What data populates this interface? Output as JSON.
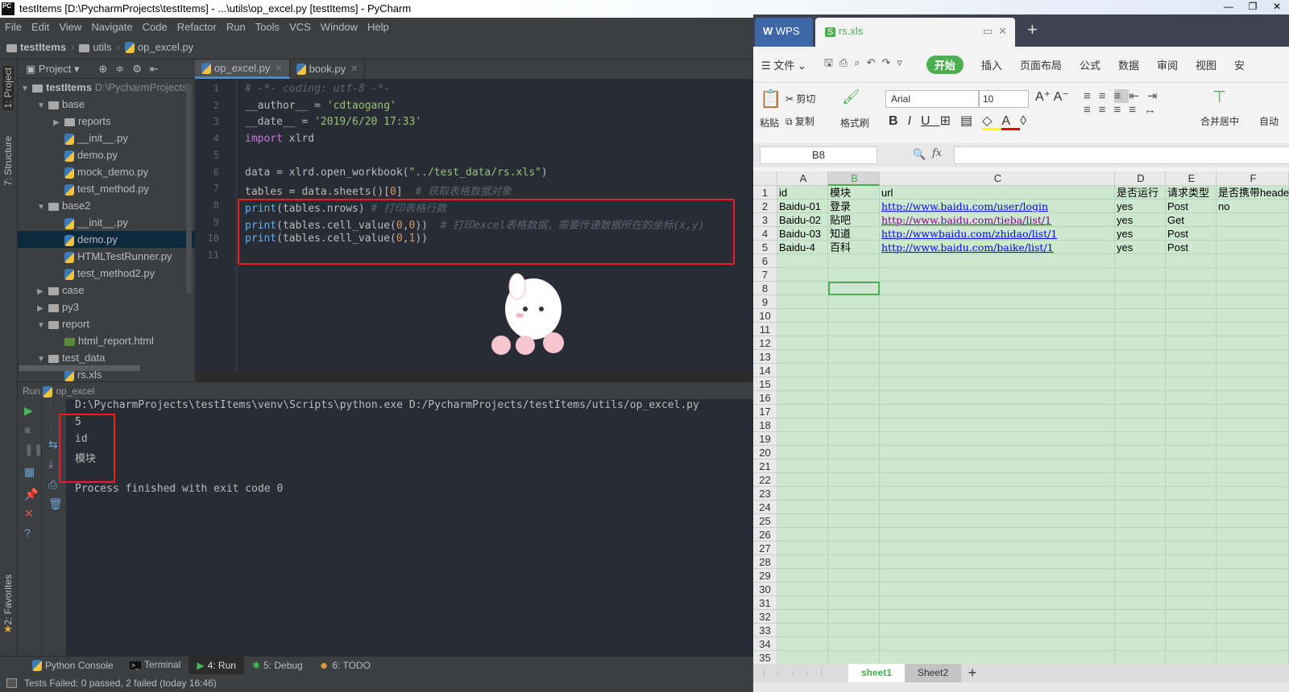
{
  "window": {
    "title": "testItems [D:\\PycharmProjects\\testItems] - ...\\utils\\op_excel.py [testItems] - PyCharm",
    "app_icon": "PC",
    "controls": [
      "—",
      "❐",
      "✕"
    ]
  },
  "menu": [
    "File",
    "Edit",
    "View",
    "Navigate",
    "Code",
    "Refactor",
    "Run",
    "Tools",
    "VCS",
    "Window",
    "Help"
  ],
  "breadcrumb": [
    "testItems",
    "utils",
    "op_excel.py"
  ],
  "side_stripe": {
    "project": "1: Project",
    "structure": "7: Structure",
    "favorites": "2: Favorites"
  },
  "project": {
    "label": "Project",
    "root": "testItems",
    "root_path": "D:\\PycharmProjects\\",
    "tree": [
      {
        "label": "base",
        "type": "folder",
        "depth": 1,
        "open": true
      },
      {
        "label": "reports",
        "type": "folder",
        "depth": 2,
        "open": false
      },
      {
        "label": "__init__.py",
        "type": "py",
        "depth": 2
      },
      {
        "label": "demo.py",
        "type": "py",
        "depth": 2
      },
      {
        "label": "mock_demo.py",
        "type": "py",
        "depth": 2
      },
      {
        "label": "test_method.py",
        "type": "py",
        "depth": 2
      },
      {
        "label": "base2",
        "type": "folder",
        "depth": 1,
        "open": true
      },
      {
        "label": "__init__.py",
        "type": "py",
        "depth": 2
      },
      {
        "label": "demo.py",
        "type": "py",
        "depth": 2,
        "selected": true
      },
      {
        "label": "HTMLTestRunner.py",
        "type": "py",
        "depth": 2
      },
      {
        "label": "test_method2.py",
        "type": "py",
        "depth": 2
      },
      {
        "label": "case",
        "type": "folder",
        "depth": 1,
        "open": false
      },
      {
        "label": "py3",
        "type": "folder",
        "depth": 1,
        "open": false
      },
      {
        "label": "report",
        "type": "folder",
        "depth": 1,
        "open": true
      },
      {
        "label": "html_report.html",
        "type": "html",
        "depth": 2
      },
      {
        "label": "test_data",
        "type": "folder",
        "depth": 1,
        "open": true
      },
      {
        "label": "rs.xls",
        "type": "xls",
        "depth": 2
      }
    ]
  },
  "editor": {
    "tabs": [
      {
        "label": "op_excel.py",
        "active": true
      },
      {
        "label": "book.py",
        "active": false
      }
    ],
    "lines": [
      [
        {
          "t": "# -*- coding: utf-8 -*-",
          "c": "cm"
        }
      ],
      [
        {
          "t": "__author__ = ",
          "c": ""
        },
        {
          "t": "'cdtaogang'",
          "c": "str"
        }
      ],
      [
        {
          "t": "__date__ = ",
          "c": ""
        },
        {
          "t": "'2019/6/20 17:33'",
          "c": "str"
        }
      ],
      [
        {
          "t": "import",
          "c": "kw"
        },
        {
          "t": " xlrd",
          "c": ""
        }
      ],
      [],
      [
        {
          "t": "data = xlrd.open_workbook(",
          "c": ""
        },
        {
          "t": "\"../test_data/rs.xls\"",
          "c": "str"
        },
        {
          "t": ")",
          "c": ""
        }
      ],
      [
        {
          "t": "tables = data.sheets()[",
          "c": ""
        },
        {
          "t": "0",
          "c": "num"
        },
        {
          "t": "]  ",
          "c": ""
        },
        {
          "t": "# 获取表格数据对象",
          "c": "cm"
        }
      ],
      [
        {
          "t": "print",
          "c": "fn"
        },
        {
          "t": "(tables.nrows) ",
          "c": ""
        },
        {
          "t": "# 打印表格行数",
          "c": "cm"
        }
      ],
      [
        {
          "t": "print",
          "c": "fn"
        },
        {
          "t": "(tables.cell_value(",
          "c": ""
        },
        {
          "t": "0",
          "c": "num"
        },
        {
          "t": ",",
          "c": ""
        },
        {
          "t": "0",
          "c": "num"
        },
        {
          "t": "))  ",
          "c": ""
        },
        {
          "t": "# 打印excel表格数据，需要传递数据所在的坐标(x,y)",
          "c": "cm"
        }
      ],
      [
        {
          "t": "print",
          "c": "fn"
        },
        {
          "t": "(tables.cell_value(",
          "c": ""
        },
        {
          "t": "0",
          "c": "num"
        },
        {
          "t": ",",
          "c": ""
        },
        {
          "t": "1",
          "c": "num"
        },
        {
          "t": "))",
          "c": ""
        }
      ],
      []
    ]
  },
  "run": {
    "header": "Run",
    "config": "op_excel",
    "output": [
      "D:\\PycharmProjects\\testItems\\venv\\Scripts\\python.exe D:/PycharmProjects/testItems/utils/op_excel.py",
      "5",
      "id",
      "模块",
      "",
      "Process finished with exit code 0"
    ]
  },
  "tool_windows": [
    {
      "label": "Python Console",
      "icon": "python-icon"
    },
    {
      "label": "Terminal",
      "icon": "terminal-icon"
    },
    {
      "label": "4: Run",
      "icon": "run-icon",
      "active": true
    },
    {
      "label": "5: Debug",
      "icon": "bug-icon"
    },
    {
      "label": "6: TODO",
      "icon": "todo-icon"
    }
  ],
  "status": "Tests Failed: 0 passed, 2 failed (today 16:46)",
  "wps": {
    "brand": "WPS",
    "file_tab": "rs.xls",
    "menu": {
      "file": "文件",
      "tabs": [
        "开始",
        "插入",
        "页面布局",
        "公式",
        "数据",
        "审阅",
        "视图",
        "安"
      ]
    },
    "ribbon": {
      "paste": "粘贴",
      "cut": "剪切",
      "copy": "复制",
      "format_painter": "格式刷",
      "font": "Arial",
      "size": "10",
      "merge": "合并居中",
      "autowrap": "自动"
    },
    "name_box": "B8",
    "fx": "fx",
    "columns": [
      "A",
      "B",
      "C",
      "D",
      "E",
      "F"
    ],
    "selected_col": "B",
    "selected_cell": "B8",
    "rows": [
      [
        "id",
        "模块",
        "url",
        "是否运行",
        "请求类型",
        "是否携带header"
      ],
      [
        "Baidu-01",
        "登录",
        "http://www.baidu.com/user/login",
        "yes",
        "Post",
        "no"
      ],
      [
        "Baidu-02",
        "贴吧",
        "http://www.baidu.com/tieba/list/1",
        "yes",
        "Get",
        ""
      ],
      [
        "Baidu-03",
        "知道",
        "http://wwwbaidu.com/zhidao/list/1",
        "yes",
        "Post",
        ""
      ],
      [
        "Baidu-4",
        "百科",
        "http://www.baidu.com/baike/list/1",
        "yes",
        "Post",
        ""
      ]
    ],
    "row_count": 35,
    "sheets": [
      {
        "label": "sheet1",
        "active": true
      },
      {
        "label": "Sheet2",
        "active": false
      }
    ],
    "accent": "#4caf50",
    "grid_bg": "#cce8cf"
  }
}
